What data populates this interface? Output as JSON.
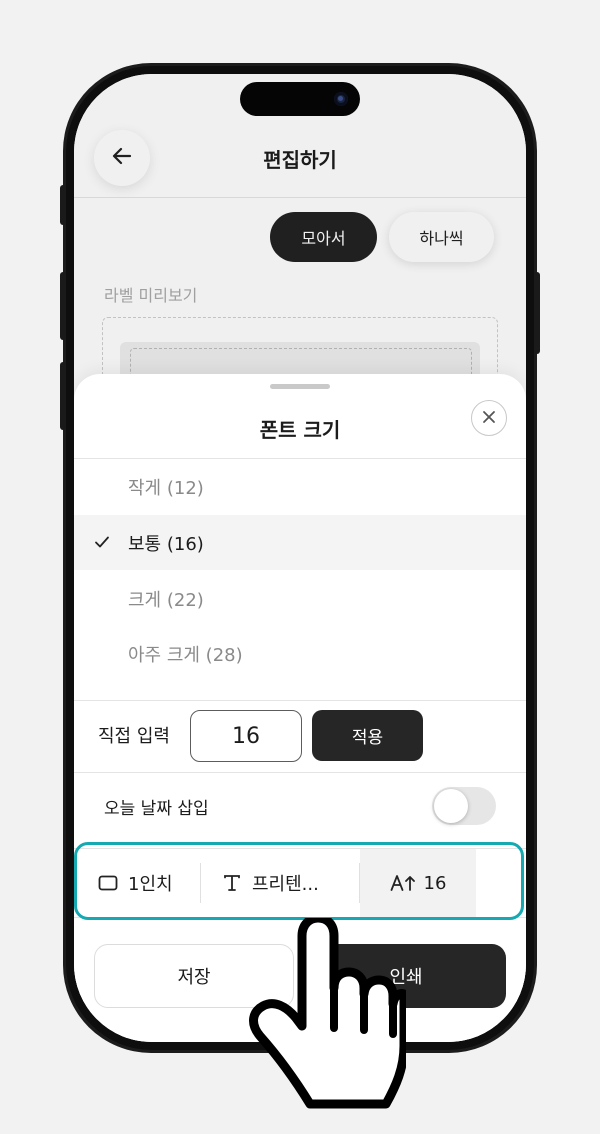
{
  "header": {
    "title": "편집하기",
    "back_icon": "arrow-left-icon"
  },
  "layout_tabs": [
    {
      "label": "모아서",
      "selected": true
    },
    {
      "label": "하나씩",
      "selected": false
    }
  ],
  "preview": {
    "label": "라벨 미리보기"
  },
  "font_sheet": {
    "title": "폰트 크기",
    "close_icon": "close-icon",
    "options": [
      {
        "label": "작게 (12)",
        "selected": false
      },
      {
        "label": "보통 (16)",
        "selected": true
      },
      {
        "label": "크게 (22)",
        "selected": false
      },
      {
        "label": "아주 크게 (28)",
        "selected": false
      }
    ],
    "direct_input": {
      "label": "직접 입력",
      "value": "16",
      "apply_label": "적용"
    },
    "date_insert": {
      "label": "오늘 날짜 삽입",
      "enabled": false
    }
  },
  "toolbar": {
    "size_label": "1인치",
    "font_label": "프리텐...",
    "fontsize_label": "16",
    "highlight_color": "#17a9b1"
  },
  "actions": {
    "save_label": "저장",
    "print_label": "인쇄"
  },
  "colors": {
    "dark_button": "#262626",
    "accent": "#17a9b1"
  }
}
